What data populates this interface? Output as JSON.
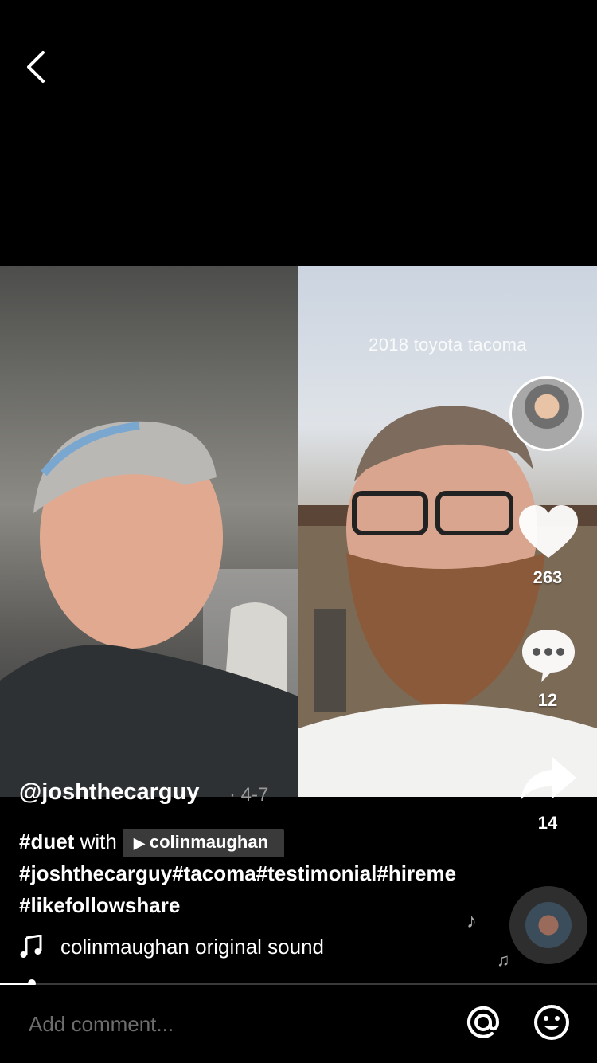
{
  "video": {
    "overlay_text": "2018 toyota tacoma"
  },
  "actions": {
    "likes": "263",
    "comments": "12",
    "shares": "14"
  },
  "post": {
    "username": "@joshthecarguy",
    "date": "· 4-7",
    "duet_tag": "#duet",
    "with_word": " with ",
    "duet_user": "colinmaughan",
    "hashtags": "#joshthecarguy#tacoma#testimonial#hireme#likefollowshare"
  },
  "music": {
    "text": "colinmaughan    original sound"
  },
  "progress": {
    "fraction": 0.053
  },
  "comment": {
    "placeholder": "Add comment..."
  },
  "icons": {
    "back": "chevron-left-icon",
    "like": "heart-icon",
    "comment": "comment-bubble-icon",
    "share": "share-arrow-icon",
    "music": "music-note-icon",
    "mention": "at-sign-icon",
    "emoji": "smiley-icon"
  }
}
